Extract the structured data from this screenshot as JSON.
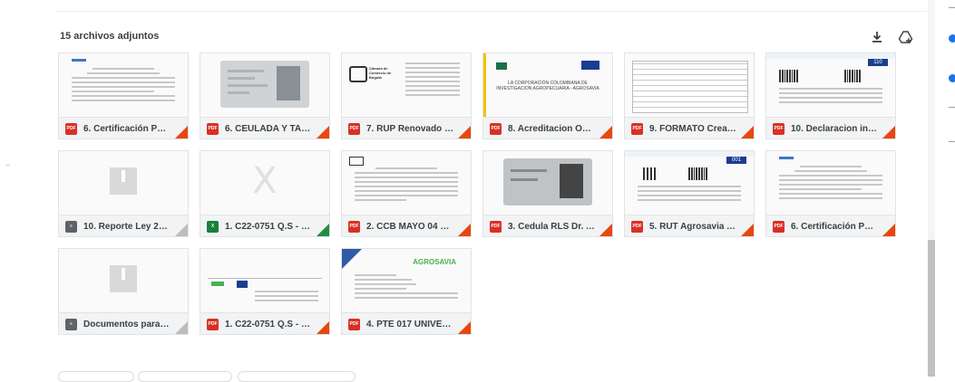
{
  "attachments": {
    "title": "15 archivos adjuntos",
    "download_all_icon": "download-icon",
    "add_to_drive_icon": "add-to-drive-icon",
    "items": [
      {
        "name": "6. Certificación Par...",
        "type": "PDF",
        "kind": "pdf"
      },
      {
        "name": "6. CEULADA Y TAR...",
        "type": "PDF",
        "kind": "pdf"
      },
      {
        "name": "7. RUP Renovado 2...",
        "type": "PDF",
        "kind": "pdf"
      },
      {
        "name": "8. Acreditacion ON...",
        "type": "PDF",
        "kind": "pdf"
      },
      {
        "name": "9. FORMATO Creac...",
        "type": "PDF",
        "kind": "pdf"
      },
      {
        "name": "10. Declaracion ing...",
        "type": "PDF",
        "kind": "pdf"
      },
      {
        "name": "10. Reporte Ley 20...",
        "type": "DOC",
        "kind": "doc"
      },
      {
        "name": "1. C22-0751 Q.S - F...",
        "type": "X",
        "kind": "xls"
      },
      {
        "name": "2. CCB MAYO 04 D...",
        "type": "PDF",
        "kind": "pdf"
      },
      {
        "name": "3. Cedula RLS Dr. A...",
        "type": "PDF",
        "kind": "pdf"
      },
      {
        "name": "5. RUT Agrosavia A...",
        "type": "PDF",
        "kind": "pdf"
      },
      {
        "name": "6. Certificación Par...",
        "type": "PDF",
        "kind": "pdf"
      },
      {
        "name": "Documentos para t...",
        "type": "DOC",
        "kind": "doc"
      },
      {
        "name": "1. C22-0751 Q.S - F...",
        "type": "PDF",
        "kind": "pdf"
      },
      {
        "name": "4. PTE 017 UNIVER...",
        "type": "PDF",
        "kind": "pdf"
      }
    ],
    "thumb_text": {
      "ccb": "Cámara de Comercio de Bogotá",
      "acreditacion": "LA CORPORACIÓN COLOMBIANA DE INVESTIGACION AGROPECUARIA - AGROSAVIA",
      "badge_110": "110",
      "badge_001": "001",
      "agrosavia": "AGROSAVIA"
    }
  },
  "colors": {
    "pdf": "#d93025",
    "xls": "#188038",
    "doc": "#5f6368",
    "accent": "#1a73e8"
  }
}
